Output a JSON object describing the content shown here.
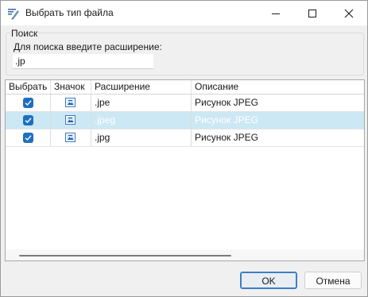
{
  "window": {
    "title": "Выбрать тип файла",
    "controls": {
      "minimize": "minimize-icon",
      "maximize": "maximize-icon",
      "close": "close-icon"
    }
  },
  "search": {
    "group_label": "Поиск",
    "hint": "Для поиска введите расширение:",
    "value": ".jp",
    "placeholder": ""
  },
  "grid": {
    "columns": [
      "Выбрать",
      "Значок",
      "Расширение",
      "Описание"
    ],
    "sorted_column": "Расширение",
    "sort_direction": "ascending",
    "rows": [
      {
        "checked": true,
        "icon": "image-file-icon",
        "extension": ".jpe",
        "description": "Рисунок JPEG",
        "selected": false
      },
      {
        "checked": true,
        "icon": "image-file-icon",
        "extension": ".jpeg",
        "description": "Рисунок JPEG",
        "selected": true
      },
      {
        "checked": true,
        "icon": "image-file-icon",
        "extension": ".jpg",
        "description": "Рисунок JPEG",
        "selected": false
      }
    ]
  },
  "buttons": {
    "ok": "OK",
    "cancel": "Отмена"
  },
  "colors": {
    "accent": "#1f6fbf",
    "selection": "#cce8f4",
    "default_button_border": "#3f7ec3"
  }
}
